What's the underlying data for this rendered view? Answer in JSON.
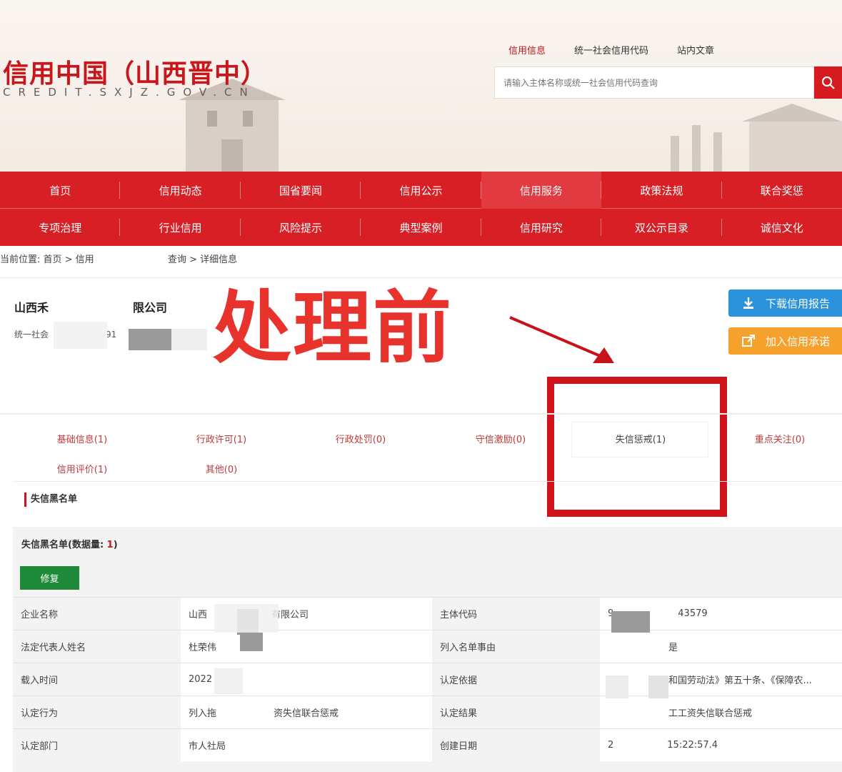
{
  "header": {
    "title": "信用中国（山西晋中）",
    "subtitle": "CREDIT.SXJZ.GOV.CN",
    "search_tabs": [
      "信用信息",
      "统一社会信用代码",
      "站内文章"
    ],
    "search_placeholder": "请输入主体名称或统一社会信用代码查询"
  },
  "nav": {
    "row1": [
      "首页",
      "信用动态",
      "国省要闻",
      "信用公示",
      "信用服务",
      "政策法规",
      "联合奖惩"
    ],
    "row2": [
      "专项治理",
      "行业信用",
      "风险提示",
      "典型案例",
      "信用研究",
      "双公示目录",
      "诚信文化"
    ]
  },
  "breadcrumb": {
    "prefix": "当前位置:  首页 > 信用",
    "suffix": "查询 > 详细信息"
  },
  "company": {
    "name_start": "山西禾",
    "name_end": "限公司",
    "code_label": "统一社会",
    "code_fragment": "91"
  },
  "actions": {
    "download": "下载信用报告",
    "commit": "加入信用承诺"
  },
  "overlay": {
    "text": "处理前"
  },
  "tabs": {
    "row1": [
      "基础信息(1)",
      "行政许可(1)",
      "行政处罚(0)",
      "守信激励(0)",
      "失信惩戒(1)",
      "重点关注(0)"
    ],
    "row2": [
      "信用评价(1)",
      "其他(0)"
    ]
  },
  "section": {
    "title": "失信黑名单",
    "block_title": "失信黑名单(数据量: ",
    "count": "1",
    "block_title_end": ")",
    "repair_label": "修复"
  },
  "table": {
    "rows": [
      {
        "l1": "企业名称",
        "v1": "山西",
        "v1b": "有限公司",
        "l2": "主体代码",
        "v2": "9",
        "v2b": "43579"
      },
      {
        "l1": "法定代表人姓名",
        "v1": "杜荣伟",
        "v1b": "",
        "l2": "列入名单事由",
        "v2": "",
        "v2b": "是"
      },
      {
        "l1": "载入时间",
        "v1": "2022",
        "v1b": "",
        "l2": "认定依据",
        "v2": "",
        "v2b": "和国劳动法》第五十条、《保障农..."
      },
      {
        "l1": "认定行为",
        "v1": "列入拖",
        "v1b": "资失信联合惩戒",
        "l2": "认定结果",
        "v2": "",
        "v2b": "工工资失信联合惩戒"
      },
      {
        "l1": "认定部门",
        "v1": "市人社局",
        "v1b": "",
        "l2": "创建日期",
        "v2": "2",
        "v2b": "15:22:57.4"
      }
    ]
  },
  "colors": {
    "brand_red": "#d71f25",
    "download_blue": "#2b93db",
    "commit_orange": "#f5a12c",
    "repair_green": "#1e8a3a"
  }
}
